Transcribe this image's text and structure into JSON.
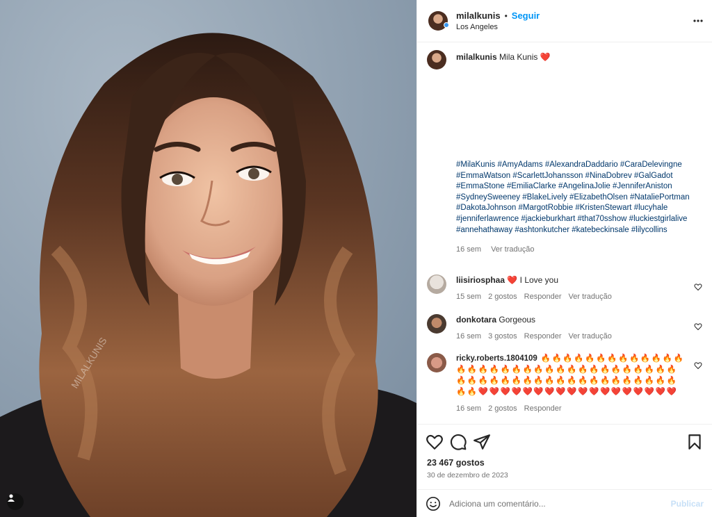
{
  "post": {
    "author": "milalkunis",
    "bullet": "•",
    "follow_label": "Seguir",
    "location": "Los Angeles",
    "watermark": "MILALKUNIS"
  },
  "caption": {
    "username": "milalkunis",
    "text": "Mila Kunis",
    "heart": "❤️",
    "hashtags": "#MilaKunis #AmyAdams #AlexandraDaddario #CaraDelevingne #EmmaWatson #ScarlettJohansson #NinaDobrev #GalGadot #EmmaStone #EmiliaClarke #AngelinaJolie #JenniferAniston #SydneySweeney #BlakeLively #ElizabethOlsen #NataliePortman #DakotaJohnson #MargotRobbie #KristenStewart #lucyhale #jenniferlawrence #jackieburkhart #that70sshow #luckiestgirlalive #annehathaway #ashtonkutcher #katebeckinsale #lilycollins",
    "age": "16 sem",
    "translate": "Ver tradução"
  },
  "comments": [
    {
      "username": "liisiriosphaa",
      "text": "❤️ I Love you",
      "age": "15 sem",
      "likes": "2 gostos",
      "reply": "Responder",
      "translate": "Ver tradução"
    },
    {
      "username": "donkotara",
      "text": "Gorgeous",
      "age": "16 sem",
      "likes": "3 gostos",
      "reply": "Responder",
      "translate": "Ver tradução"
    },
    {
      "username": "ricky.roberts.1804109",
      "line1": "🔥🔥🔥🔥🔥🔥🔥🔥🔥🔥🔥🔥🔥",
      "line2": "🔥🔥🔥🔥🔥🔥🔥🔥🔥🔥🔥🔥🔥🔥🔥🔥🔥🔥🔥🔥",
      "line3": "🔥🔥🔥🔥🔥🔥🔥🔥🔥🔥🔥🔥🔥🔥🔥🔥🔥🔥🔥🔥",
      "line4": "🔥🔥❤️❤️❤️❤️❤️❤️❤️❤️❤️❤️❤️❤️❤️❤️❤️❤️❤️❤️",
      "age": "16 sem",
      "likes": "2 gostos",
      "reply": "Responder"
    }
  ],
  "stats": {
    "likes": "23 467 gostos",
    "date": "30 de dezembro de 2023"
  },
  "composer": {
    "placeholder": "Adiciona um comentário...",
    "publish_label": "Publicar"
  },
  "icons": {
    "like": "heart-outline-icon",
    "comment": "speech-bubble-icon",
    "share": "paper-plane-icon",
    "save": "bookmark-icon",
    "more": "more-horizontal-icon",
    "emoji": "emoji-smile-icon",
    "tagged_user": "user-tag-icon"
  },
  "colors": {
    "accent": "#0095f6",
    "hashtag": "#00376b",
    "muted": "#737373",
    "heart": "#ed1d34",
    "publish_disabled": "#c7e0f7"
  }
}
